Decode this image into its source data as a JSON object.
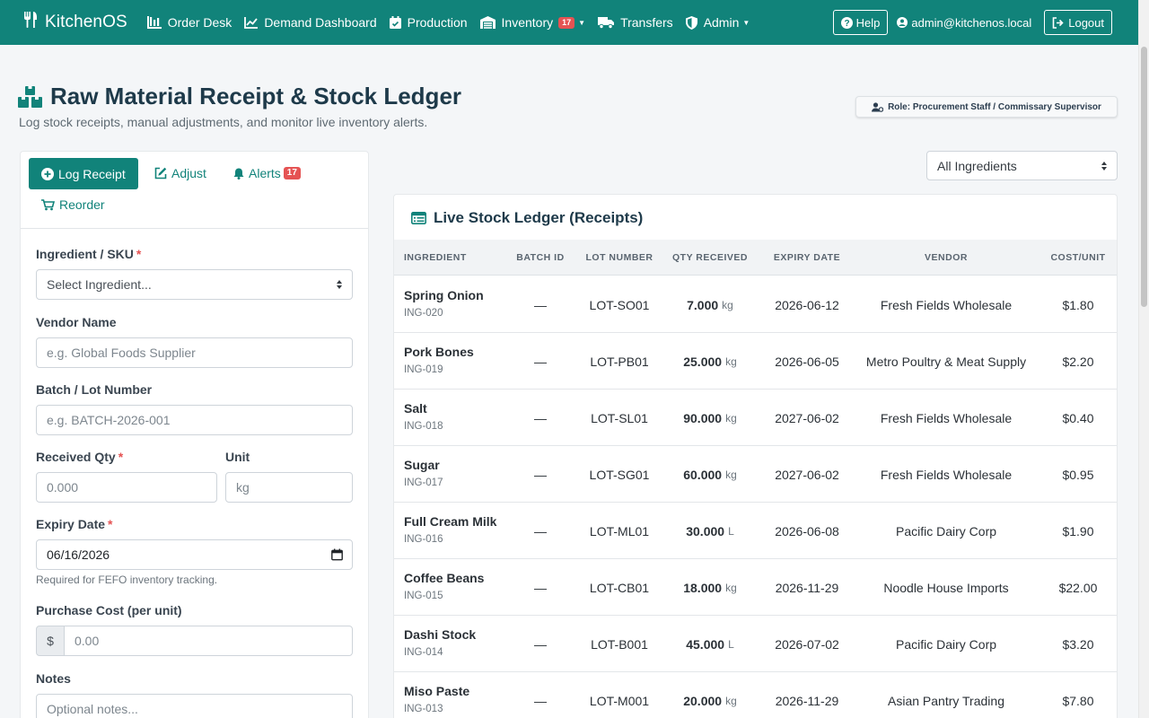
{
  "navbar": {
    "brand": "KitchenOS",
    "items": [
      {
        "label": "Order Desk",
        "icon": "tools-icon"
      },
      {
        "label": "Demand Dashboard",
        "icon": "chart-icon"
      },
      {
        "label": "Production",
        "icon": "calendar-check-icon"
      },
      {
        "label": "Inventory",
        "icon": "warehouse-icon",
        "badge": "17"
      },
      {
        "label": "Transfers",
        "icon": "truck-icon"
      },
      {
        "label": "Admin",
        "icon": "shield-icon"
      }
    ],
    "help_label": "Help",
    "user_email": "admin@kitchenos.local",
    "logout_label": "Logout"
  },
  "header": {
    "title": "Raw Material Receipt & Stock Ledger",
    "subtitle": "Log stock receipts, manual adjustments, and monitor live inventory alerts.",
    "role_badge": "Role: Procurement Staff / Commissary Supervisor"
  },
  "tabs": {
    "log_receipt": "Log Receipt",
    "adjust": "Adjust",
    "alerts": "Alerts",
    "alerts_count": "17",
    "reorder": "Reorder"
  },
  "form": {
    "ingredient_label": "Ingredient / SKU",
    "ingredient_value": "Select Ingredient...",
    "vendor_label": "Vendor Name",
    "vendor_placeholder": "e.g. Global Foods Supplier",
    "batch_label": "Batch / Lot Number",
    "batch_placeholder": "e.g. BATCH-2026-001",
    "qty_label": "Received Qty",
    "qty_placeholder": "0.000",
    "unit_label": "Unit",
    "unit_placeholder": "kg",
    "expiry_label": "Expiry Date",
    "expiry_value": "06/16/2026",
    "expiry_help": "Required for FEFO inventory tracking.",
    "cost_label": "Purchase Cost (per unit)",
    "cost_prefix": "$",
    "cost_placeholder": "0.00",
    "notes_label": "Notes",
    "notes_placeholder": "Optional notes...",
    "required_mark": "*"
  },
  "filter": {
    "selected": "All Ingredients"
  },
  "ledger": {
    "title": "Live Stock Ledger (Receipts)",
    "columns": [
      "INGREDIENT",
      "BATCH ID",
      "LOT NUMBER",
      "QTY RECEIVED",
      "EXPIRY DATE",
      "VENDOR",
      "COST/UNIT"
    ],
    "rows": [
      {
        "name": "Spring Onion",
        "code": "ING-020",
        "batch": "—",
        "lot": "LOT-SO01",
        "qty": "7.000",
        "unit": "kg",
        "expiry": "2026-06-12",
        "vendor": "Fresh Fields Wholesale",
        "cost": "$1.80"
      },
      {
        "name": "Pork Bones",
        "code": "ING-019",
        "batch": "—",
        "lot": "LOT-PB01",
        "qty": "25.000",
        "unit": "kg",
        "expiry": "2026-06-05",
        "vendor": "Metro Poultry & Meat Supply",
        "cost": "$2.20"
      },
      {
        "name": "Salt",
        "code": "ING-018",
        "batch": "—",
        "lot": "LOT-SL01",
        "qty": "90.000",
        "unit": "kg",
        "expiry": "2027-06-02",
        "vendor": "Fresh Fields Wholesale",
        "cost": "$0.40"
      },
      {
        "name": "Sugar",
        "code": "ING-017",
        "batch": "—",
        "lot": "LOT-SG01",
        "qty": "60.000",
        "unit": "kg",
        "expiry": "2027-06-02",
        "vendor": "Fresh Fields Wholesale",
        "cost": "$0.95"
      },
      {
        "name": "Full Cream Milk",
        "code": "ING-016",
        "batch": "—",
        "lot": "LOT-ML01",
        "qty": "30.000",
        "unit": "L",
        "expiry": "2026-06-08",
        "vendor": "Pacific Dairy Corp",
        "cost": "$1.90"
      },
      {
        "name": "Coffee Beans",
        "code": "ING-015",
        "batch": "—",
        "lot": "LOT-CB01",
        "qty": "18.000",
        "unit": "kg",
        "expiry": "2026-11-29",
        "vendor": "Noodle House Imports",
        "cost": "$22.00"
      },
      {
        "name": "Dashi Stock",
        "code": "ING-014",
        "batch": "—",
        "lot": "LOT-B001",
        "qty": "45.000",
        "unit": "L",
        "expiry": "2026-07-02",
        "vendor": "Pacific Dairy Corp",
        "cost": "$3.20"
      },
      {
        "name": "Miso Paste",
        "code": "ING-013",
        "batch": "—",
        "lot": "LOT-M001",
        "qty": "20.000",
        "unit": "kg",
        "expiry": "2026-11-29",
        "vendor": "Asian Pantry Trading",
        "cost": "$7.80"
      }
    ]
  },
  "colors": {
    "primary": "#11837a",
    "danger": "#e55353",
    "heading": "#1e3a4a"
  }
}
